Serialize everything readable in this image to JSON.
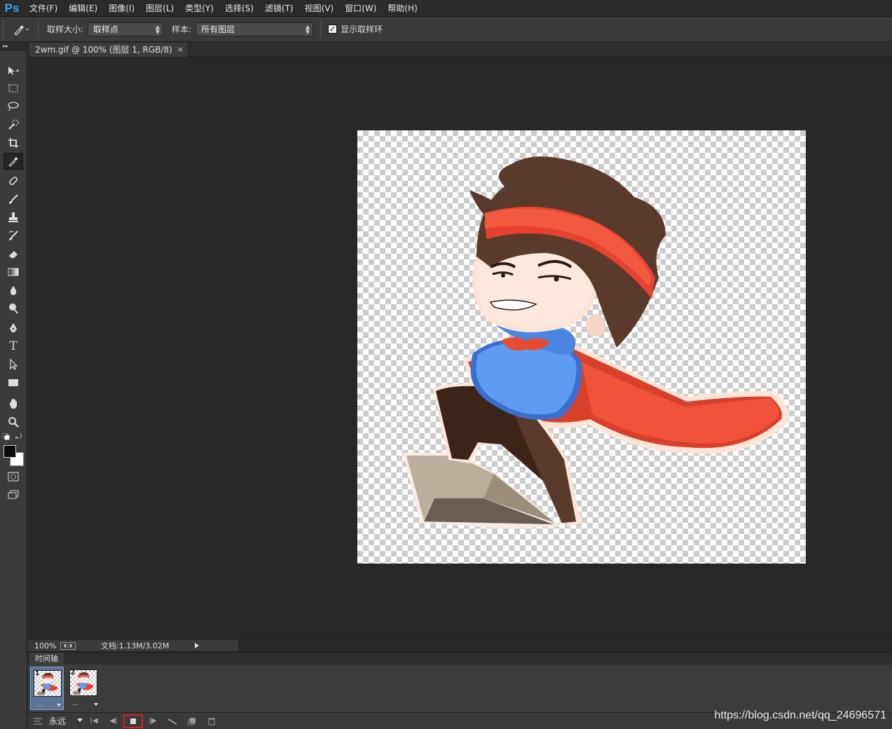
{
  "app": {
    "logo": "Ps"
  },
  "menu": [
    "文件(F)",
    "编辑(E)",
    "图像(I)",
    "图层(L)",
    "类型(Y)",
    "选择(S)",
    "滤镜(T)",
    "视图(V)",
    "窗口(W)",
    "帮助(H)"
  ],
  "options": {
    "sample_size_label": "取样大小:",
    "sample_size_value": "取样点",
    "sample_label": "样本:",
    "sample_value": "所有图层",
    "show_ring_label": "显示取样环",
    "show_ring_checked": true
  },
  "document": {
    "tab_title": "2wm.gif @ 100% (图层 1, RGB/8)",
    "close": "×"
  },
  "status": {
    "zoom": "100%",
    "doc_info": "文档:1.13M/3.02M"
  },
  "timeline": {
    "tab_label": "时间轴",
    "frames": [
      {
        "number": "1",
        "delay": "...",
        "selected": true
      },
      {
        "number": "2",
        "delay": "...",
        "selected": false
      }
    ],
    "loop_value": "永远"
  },
  "watermark": "https://blog.csdn.net/qq_24696571",
  "colors": {
    "accent": "#3fa0ef",
    "stop_highlight": "#d81f1f",
    "background": "#282828"
  }
}
